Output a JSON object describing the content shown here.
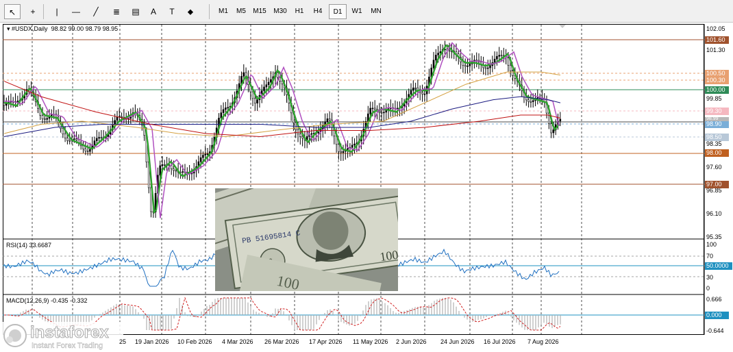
{
  "toolbar": {
    "tools": [
      {
        "name": "cursor",
        "glyph": "↖"
      },
      {
        "name": "crosshair",
        "glyph": "+"
      },
      {
        "name": "vertical-line",
        "glyph": "|"
      },
      {
        "name": "horizontal-line",
        "glyph": "—"
      },
      {
        "name": "trendline",
        "glyph": "╱"
      },
      {
        "name": "fibonacci",
        "glyph": "≣"
      },
      {
        "name": "channel",
        "glyph": "▤"
      },
      {
        "name": "text",
        "glyph": "A"
      },
      {
        "name": "text-label",
        "glyph": "T"
      },
      {
        "name": "shapes",
        "glyph": "⬥"
      }
    ],
    "timeframes": [
      "M1",
      "M5",
      "M15",
      "M30",
      "H1",
      "H4",
      "D1",
      "W1",
      "MN"
    ],
    "active_timeframe": "D1"
  },
  "main_chart": {
    "symbol": "#USDX,Daily",
    "ohlc": "98.82 99.00 98.79 98.95",
    "price_ticks": [
      "102.05",
      "101.30",
      "99.85",
      "98.35",
      "97.60",
      "96.85",
      "96.10",
      "95.35"
    ],
    "price_tags": [
      {
        "label": "101.60",
        "color": "#a0522d"
      },
      {
        "label": "100.50",
        "color": "#e8a070"
      },
      {
        "label": "100.30",
        "color": "#e8a070"
      },
      {
        "label": "100.00",
        "color": "#2e8b57"
      },
      {
        "label": "99.30",
        "color": "#f5b8c0"
      },
      {
        "label": "98.90",
        "color": "#7aaed8"
      },
      {
        "label": "98.50",
        "color": "#b8c8d8"
      },
      {
        "label": "98.00",
        "color": "#c06020"
      },
      {
        "label": "97.00",
        "color": "#a0522d"
      }
    ],
    "hidden_tick": "98.99"
  },
  "rsi": {
    "title": "RSI(14) 33.6687",
    "ticks": [
      "100",
      "70",
      "50.0000",
      "30",
      "0"
    ],
    "level_color": "#1e90c0"
  },
  "macd": {
    "title": "MACD(12,26,9) -0.435 -0.332",
    "ticks": [
      "0.666",
      "0.000",
      "-0.644"
    ],
    "zero_tag_color": "#1e90c0"
  },
  "dates": [
    "19 Jan 2026",
    "10 Feb 2026",
    "4 Mar 2026",
    "26 Mar 2026",
    "17 Apr 2026",
    "11 May 2026",
    "2 Jun 2026",
    "24 Jun 2026",
    "16 Jul 2026",
    "7 Aug 2026"
  ],
  "date_partial": "25",
  "logo": {
    "brand": "instaforex",
    "tagline": "Instant Forex Trading"
  },
  "photo": {
    "bill_text": "PB 51695814 C"
  },
  "chart_data": {
    "type": "candlestick",
    "symbol": "#USDX",
    "timeframe": "Daily",
    "last": {
      "open": 98.82,
      "high": 99.0,
      "low": 98.79,
      "close": 98.95
    },
    "ylim": [
      95.35,
      102.05
    ],
    "horizontal_levels": [
      101.6,
      100.5,
      100.3,
      100.0,
      99.3,
      98.9,
      98.5,
      98.0,
      97.0
    ],
    "rsi": {
      "period": 14,
      "value": 33.6687,
      "levels": [
        70,
        50,
        30
      ]
    },
    "macd": {
      "params": "12,26,9",
      "macd": -0.435,
      "signal": -0.332,
      "ylim": [
        -0.644,
        0.666
      ]
    }
  }
}
